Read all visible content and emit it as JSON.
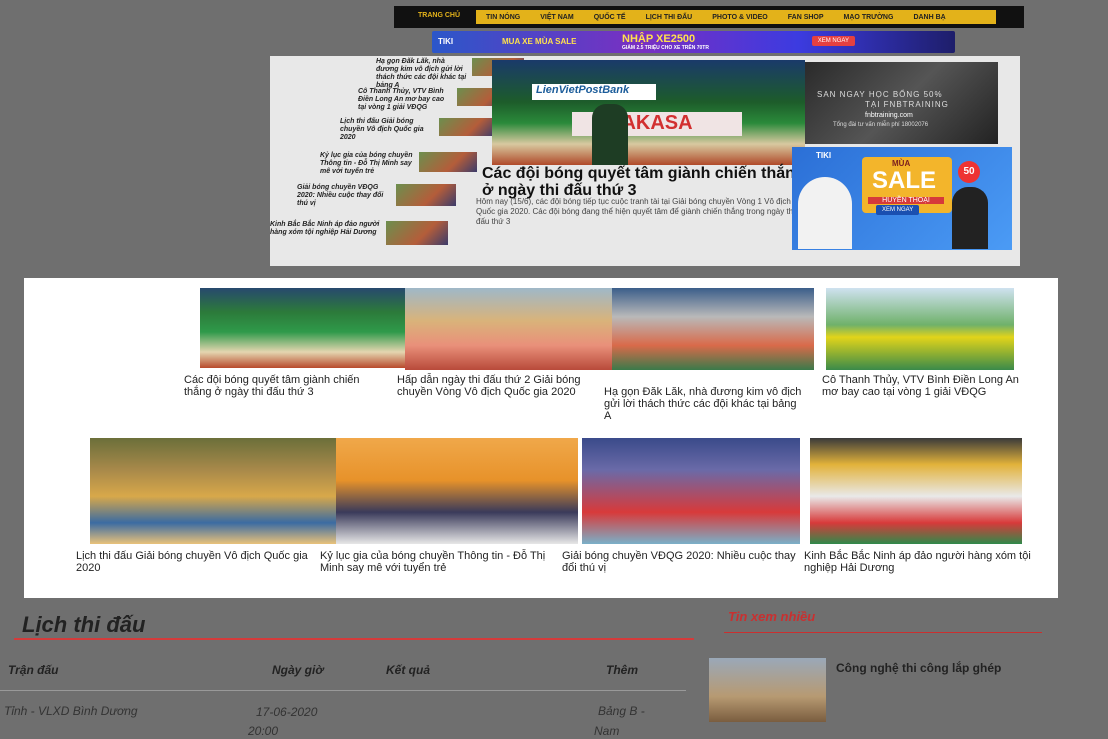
{
  "nav": {
    "home": "Trang chủ",
    "items": [
      "Tin nóng",
      "Việt Nam",
      "Quốc tế",
      "Lịch thi đấu",
      "Photo & Video",
      "Fan shop",
      "Mạo trường",
      "Danh bạ"
    ]
  },
  "top_banner": {
    "brand": "TIKI",
    "left_text": "MUA XE MÙA SALE",
    "code": "NHẬP XE2500",
    "sub": "GIẢM 2.5 TRIỆU CHO XE TRÊN 70TR",
    "cta": "XEM NGAY"
  },
  "side_news": [
    "Hạ gọn Đăk Lăk, nhà đương kim vô địch gửi lời thách thức các đội khác tại bảng A",
    "Cô Thanh Thủy, VTV Bình Điền Long An mơ bay cao tại vòng 1 giải VĐQG",
    "Lịch thi đấu Giải bóng chuyền Vô địch Quốc gia 2020",
    "Kỷ lục gia của bóng chuyền Thông tin - Đỗ Thị Minh say mê với tuyển trẻ",
    "Giải bóng chuyền VĐQG 2020: Nhiều cuộc thay đổi thú vị",
    "Kinh Bắc Bắc Ninh áp đảo người hàng xóm tội nghiệp Hải Dương"
  ],
  "feature": {
    "title": "Các đội bóng quyết tâm giành chiến thắng ở ngày thi đấu thứ 3",
    "desc": "Hôm nay (15/6), các đội bóng tiếp tục cuộc tranh tài tại Giải bóng chuyền Vòng 1 Vô địch Quốc gia 2020. Các đội bóng đang thể hiện quyết tâm để giành chiến thắng trong ngày thi đấu thứ 3",
    "sponsor1": "LienVietPostBank",
    "sponsor2": "AKASA"
  },
  "ad_right1": {
    "line1": "SAN NGAY HỌC BỔNG 50%",
    "line2": "TẠI FNBTRAINING",
    "line3": "fnbtraining.com",
    "line4": "Tổng đài tư vấn miễn phí 18002076"
  },
  "ad_right2": {
    "brand": "TIKI",
    "line1": "MÙA",
    "line2": "SALE",
    "line3": "HUYỀN THOẠI",
    "badge": "50",
    "cta": "XEM NGAY"
  },
  "grid": [
    "Các đội bóng quyết tâm giành chiến thắng ở ngày thi đấu thứ 3",
    "Hấp dẫn ngày thi đấu thứ 2 Giải bóng chuyền Vòng Vô địch Quốc gia 2020",
    "Hạ gọn Đăk Lăk, nhà đương kim vô địch gửi lời thách thức các đội khác tại bảng A",
    "Cô Thanh Thủy, VTV Bình Điền Long An mơ bay cao tại vòng 1 giải VĐQG",
    "Lịch thi đấu Giải bóng chuyền Vô địch Quốc gia 2020",
    "Kỷ lục gia của bóng chuyền Thông tin - Đỗ Thị Minh say mê với tuyển trẻ",
    "Giải bóng chuyền VĐQG 2020: Nhiều cuộc thay đổi thú vị",
    "Kinh Bắc Bắc Ninh áp đảo người hàng xóm tội nghiệp Hải Dương"
  ],
  "schedule": {
    "title": "Lịch thi đấu",
    "headers": [
      "Trận đấu",
      "Ngày giờ",
      "Kết quả",
      "Thêm"
    ],
    "row": {
      "match": "Tỉnh - VLXD Bình Dương",
      "date": "17-06-2020",
      "time": "20:00",
      "more1": "Bảng B -",
      "more2": "Nam"
    }
  },
  "most_read": {
    "title": "Tin xem nhiều",
    "item": "Công nghệ thi công lắp ghép"
  }
}
